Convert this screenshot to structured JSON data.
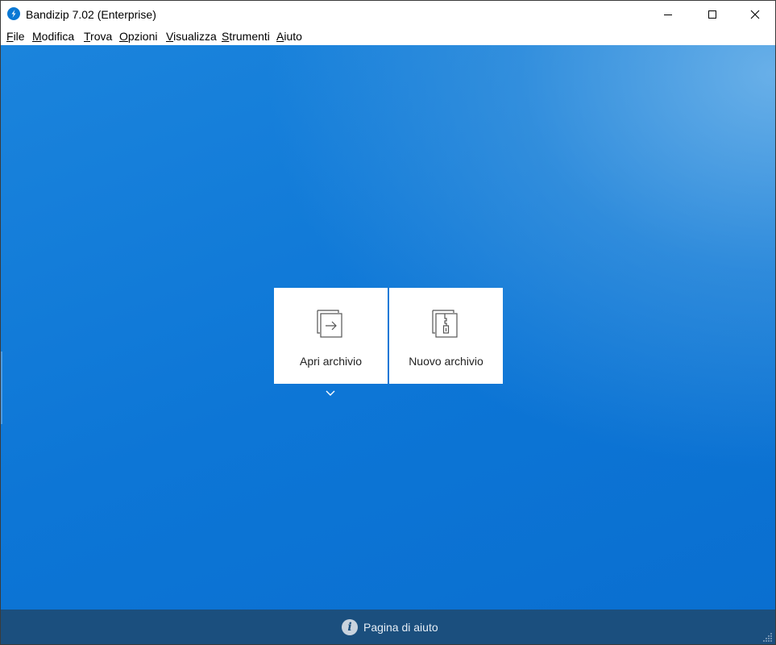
{
  "window": {
    "title": "Bandizip 7.02 (Enterprise)",
    "accent_color": "#0a78d4"
  },
  "menu": [
    {
      "accel": "F",
      "rest": "ile"
    },
    {
      "accel": "M",
      "rest": "odifica"
    },
    {
      "accel": "T",
      "rest": "rova"
    },
    {
      "accel": "O",
      "rest": "pzioni"
    },
    {
      "accel": "V",
      "rest": "isualizza"
    },
    {
      "accel": "S",
      "rest": "trumenti"
    },
    {
      "accel": "A",
      "rest": "iuto"
    }
  ],
  "main": {
    "open_archive_label": "Apri archivio",
    "new_archive_label": "Nuovo archivio",
    "background_color": "#0d76d6"
  },
  "footer": {
    "help_label": "Pagina di aiuto",
    "help_icon_glyph": "i",
    "background_color": "#1b4f7e"
  }
}
